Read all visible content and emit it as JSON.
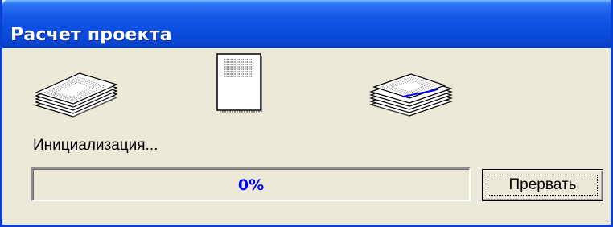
{
  "window": {
    "title": "Расчет проекта"
  },
  "animation": {
    "source_icon": "stacked-documents-icon",
    "flying_icon": "document-page-icon",
    "target_icon": "stacked-documents-done-icon"
  },
  "status": {
    "text": "Инициализация..."
  },
  "progress": {
    "value": 0,
    "label": "0%",
    "label_color": "#0000ff"
  },
  "buttons": {
    "abort_label": "Прервать"
  },
  "colors": {
    "titlebar": "#0b4fe0",
    "window_bg": "#ece9d8",
    "border": "#0a3fd6"
  }
}
